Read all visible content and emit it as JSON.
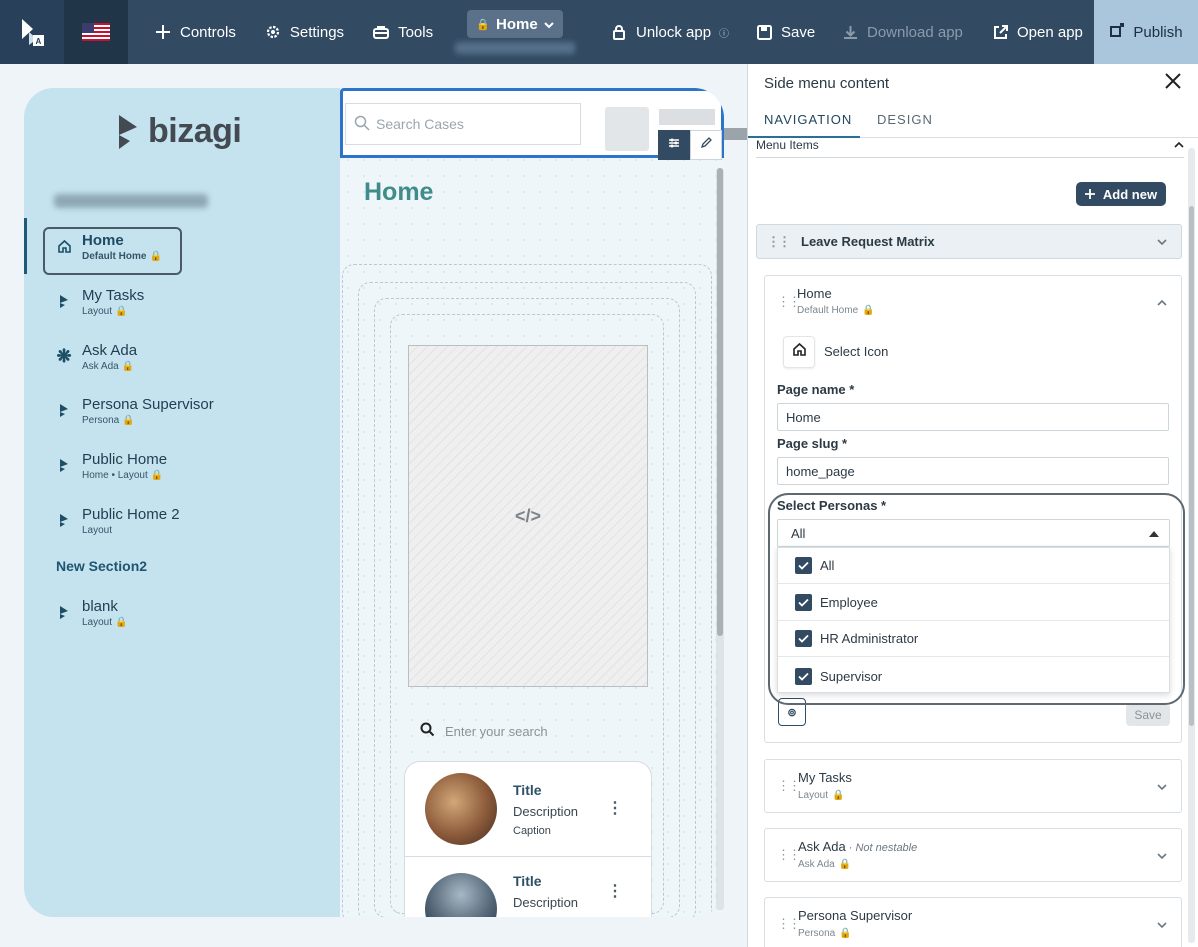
{
  "topbar": {
    "controls": "Controls",
    "settings": "Settings",
    "tools": "Tools",
    "home": "Home",
    "unlock": "Unlock app",
    "save": "Save",
    "download": "Download app",
    "open": "Open app",
    "publish": "Publish"
  },
  "preview": {
    "brand": "bizagi",
    "sidebar_items": [
      {
        "label": "Home",
        "sub": "Default Home"
      },
      {
        "label": "My Tasks",
        "sub": "Layout"
      },
      {
        "label": "Ask Ada",
        "sub": "Ask Ada"
      },
      {
        "label": "Persona Supervisor",
        "sub": "Persona"
      },
      {
        "label": "Public Home",
        "sub": "Home • Layout"
      },
      {
        "label": "Public Home 2",
        "sub": "Layout"
      }
    ],
    "section": "New Section2",
    "section_items": [
      {
        "label": "blank",
        "sub": "Layout"
      }
    ],
    "search_placeholder": "Search Cases",
    "page_title": "Home",
    "code_placeholder": "</>",
    "list_search": "Enter your search",
    "cards": [
      {
        "title": "Title",
        "description": "Description",
        "caption": "Caption"
      },
      {
        "title": "Title",
        "description": "Description"
      }
    ]
  },
  "panel": {
    "title": "Side menu content",
    "tabs": [
      "NAVIGATION",
      "DESIGN"
    ],
    "menu_items": "Menu Items",
    "add_new": "Add new",
    "group": "Leave Request Matrix",
    "home_card": {
      "title": "Home",
      "sub": "Default Home",
      "select_icon": "Select Icon",
      "page_name_label": "Page name *",
      "page_name": "Home",
      "slug_label": "Page slug *",
      "slug": "home_page",
      "personas_label": "Select Personas *",
      "personas_value": "All",
      "options": [
        "All",
        "Employee",
        "HR Administrator",
        "Supervisor"
      ],
      "save": "Save"
    },
    "other_items": [
      {
        "title": "My Tasks",
        "note": "",
        "sub": "Layout"
      },
      {
        "title": "Ask Ada",
        "note": " · Not nestable",
        "sub": "Ask Ada"
      },
      {
        "title": "Persona Supervisor",
        "note": "",
        "sub": "Persona"
      }
    ]
  },
  "colors": {
    "topbar": "#324b63",
    "sidebar": "#c4e3ef",
    "accent": "#2b74c9",
    "title_teal": "#3f8c8a"
  }
}
